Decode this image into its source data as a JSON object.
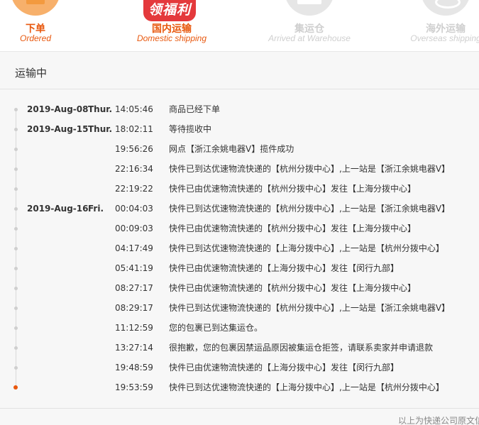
{
  "steps": [
    {
      "name": "下单",
      "sub": "Ordered",
      "state": "done",
      "icon": "cart-icon"
    },
    {
      "name": "国内运输",
      "sub": "Domestic shipping",
      "state": "current",
      "badge": "领福利"
    },
    {
      "name": "集运仓",
      "sub": "Arrived at Warehouse",
      "state": "pending",
      "icon": "warehouse-icon"
    },
    {
      "name": "海外运输",
      "sub": "Overseas shipping",
      "state": "pending",
      "icon": "airplane-icon"
    }
  ],
  "panel": {
    "title": "运输中",
    "footer_note": "以上为快递公司原文信息"
  },
  "logs": [
    {
      "date": "2019-Aug-08",
      "weekday": "Thur.",
      "time": "14:05:46",
      "msg": "商品已经下单"
    },
    {
      "date": "2019-Aug-15",
      "weekday": "Thur.",
      "time": "18:02:11",
      "msg": "等待揽收中"
    },
    {
      "date": "",
      "weekday": "",
      "time": "19:56:26",
      "msg": "网点【浙江余姚电器V】揽件成功"
    },
    {
      "date": "",
      "weekday": "",
      "time": "22:16:34",
      "msg": "快件已到达优速物流快递的【杭州分拨中心】,上一站是【浙江余姚电器V】"
    },
    {
      "date": "",
      "weekday": "",
      "time": "22:19:22",
      "msg": "快件已由优速物流快递的【杭州分拨中心】发往【上海分拨中心】"
    },
    {
      "date": "2019-Aug-16",
      "weekday": "Fri.",
      "time": "00:04:03",
      "msg": "快件已到达优速物流快递的【杭州分拨中心】,上一站是【浙江余姚电器V】"
    },
    {
      "date": "",
      "weekday": "",
      "time": "00:09:03",
      "msg": "快件已由优速物流快递的【杭州分拨中心】发往【上海分拨中心】"
    },
    {
      "date": "",
      "weekday": "",
      "time": "04:17:49",
      "msg": "快件已到达优速物流快递的【上海分拨中心】,上一站是【杭州分拨中心】"
    },
    {
      "date": "",
      "weekday": "",
      "time": "05:41:19",
      "msg": "快件已由优速物流快递的【上海分拨中心】发往【闵行九部】"
    },
    {
      "date": "",
      "weekday": "",
      "time": "08:27:17",
      "msg": "快件已由优速物流快递的【杭州分拨中心】发往【上海分拨中心】"
    },
    {
      "date": "",
      "weekday": "",
      "time": "08:29:17",
      "msg": "快件已到达优速物流快递的【杭州分拨中心】,上一站是【浙江余姚电器V】"
    },
    {
      "date": "",
      "weekday": "",
      "time": "11:12:59",
      "msg": "您的包裹已到达集运仓。"
    },
    {
      "date": "",
      "weekday": "",
      "time": "13:27:14",
      "msg": "很抱歉，您的包裹因禁运品原因被集运仓拒签，请联系卖家并申请退款"
    },
    {
      "date": "",
      "weekday": "",
      "time": "19:48:59",
      "msg": "快件已由优速物流快递的【上海分拨中心】发往【闵行九部】"
    },
    {
      "date": "",
      "weekday": "",
      "time": "19:53:59",
      "msg": "快件已到达优速物流快递的【上海分拨中心】,上一站是【杭州分拨中心】"
    }
  ],
  "colors": {
    "accent": "#e8580e",
    "badge_red": "#e4393c",
    "pending_gray": "#cfcfcf",
    "panel_bg": "#f7f7f7"
  }
}
